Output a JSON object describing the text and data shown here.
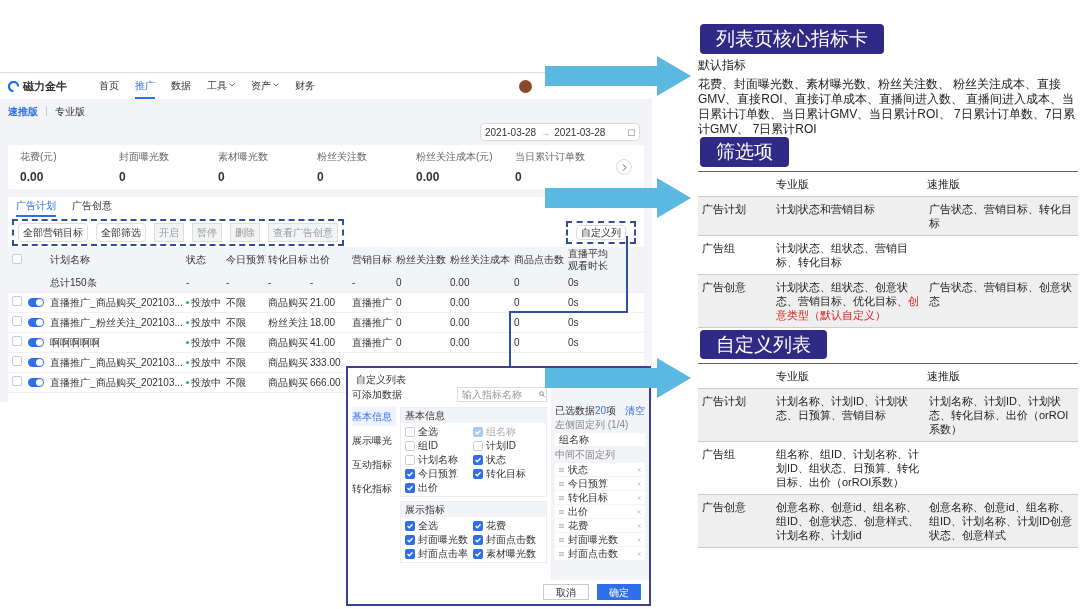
{
  "app": {
    "logo": "磁力金牛",
    "nav": [
      {
        "label": "首页",
        "selected": false,
        "dropdown": false
      },
      {
        "label": "推广",
        "selected": true,
        "dropdown": false
      },
      {
        "label": "数据",
        "selected": false,
        "dropdown": false
      },
      {
        "label": "工具",
        "selected": false,
        "dropdown": true
      },
      {
        "label": "资产",
        "selected": false,
        "dropdown": true
      },
      {
        "label": "财务",
        "selected": false,
        "dropdown": false
      }
    ],
    "versions": [
      {
        "label": "速推版",
        "selected": true
      },
      {
        "label": "专业版",
        "selected": false
      }
    ],
    "date_range": {
      "start": "2021-03-28",
      "separator": "→",
      "end": "2021-03-28"
    },
    "metrics": [
      {
        "label": "花费(元)",
        "value": "0.00"
      },
      {
        "label": "封面曝光数",
        "value": "0"
      },
      {
        "label": "素材曝光数",
        "value": "0"
      },
      {
        "label": "粉丝关注数",
        "value": "0"
      },
      {
        "label": "粉丝关注成本(元)",
        "value": "0.00"
      },
      {
        "label": "当日累计订单数",
        "value": "0"
      }
    ],
    "tabs": [
      {
        "label": "广告计划",
        "selected": true
      },
      {
        "label": "广告创意",
        "selected": false
      }
    ],
    "filters": [
      "全部营销目标",
      "全部筛选"
    ],
    "actions": [
      {
        "label": "开启",
        "disabled": true
      },
      {
        "label": "暂停",
        "disabled": true
      },
      {
        "label": "删除",
        "disabled": true
      },
      {
        "label": "查看广告创意",
        "disabled": true
      }
    ],
    "custom_columns_button": "自定义列",
    "select_all_checked": false,
    "columns": [
      "计划名称",
      "状态",
      "今日预算",
      "转化目标",
      "出价",
      "营销目标",
      "粉丝关注数",
      "粉丝关注成本",
      "商品点击数",
      "直播平均观看时长"
    ],
    "rows": [
      {
        "kind": "total",
        "cells": [
          "总计150条",
          "-",
          "-",
          "-",
          "-",
          "-",
          "0",
          "0.00",
          "0",
          "0s"
        ]
      },
      {
        "kind": "plan",
        "checked": false,
        "on": true,
        "cells": [
          "直播推广_商品购买_202103...",
          "投放中",
          "不限",
          "商品购买",
          "21.00",
          "直播推广",
          "0",
          "0.00",
          "0",
          "0s"
        ]
      },
      {
        "kind": "plan",
        "checked": false,
        "on": true,
        "cells": [
          "直播推广_粉丝关注_202103...",
          "投放中",
          "不限",
          "粉丝关注",
          "18.00",
          "直播推广",
          "0",
          "0.00",
          "0",
          "0s"
        ]
      },
      {
        "kind": "plan",
        "checked": false,
        "on": true,
        "cells": [
          "啊啊啊啊啊",
          "投放中",
          "不限",
          "商品购买",
          "41.00",
          "直播推广",
          "0",
          "0.00",
          "0",
          "0s"
        ]
      },
      {
        "kind": "plan",
        "checked": false,
        "on": true,
        "cells": [
          "直播推广_商品购买_202103...",
          "投放中",
          "不限",
          "商品购买",
          "333.00"
        ]
      },
      {
        "kind": "plan",
        "checked": false,
        "on": true,
        "cells": [
          "直播推广_商品购买_202103...",
          "投放中",
          "不限",
          "商品购买",
          "666.00"
        ]
      }
    ]
  },
  "dialog": {
    "title": "自定义列表",
    "subtitle": "可添加数据",
    "search": {
      "placeholder": "输入指标名称"
    },
    "categories": [
      {
        "label": "基本信息",
        "selected": true
      },
      {
        "label": "展示曝光",
        "selected": false
      },
      {
        "label": "互动指标",
        "selected": false
      },
      {
        "label": "转化指标",
        "selected": false
      }
    ],
    "sections": [
      {
        "title": "基本信息",
        "options": [
          {
            "label": "全选",
            "checked": false,
            "disabled": false
          },
          {
            "label": "组名称",
            "checked": true,
            "disabled": true
          },
          {
            "label": "组ID",
            "checked": false,
            "disabled": false
          },
          {
            "label": "计划ID",
            "checked": false,
            "disabled": false
          },
          {
            "label": "计划名称",
            "checked": false,
            "disabled": false
          },
          {
            "label": "状态",
            "checked": true,
            "disabled": false
          },
          {
            "label": "今日预算",
            "checked": true,
            "disabled": false
          },
          {
            "label": "转化目标",
            "checked": true,
            "disabled": false
          },
          {
            "label": "出价",
            "checked": true,
            "disabled": false
          }
        ]
      },
      {
        "title": "展示指标",
        "options": [
          {
            "label": "全选",
            "checked": true,
            "disabled": false
          },
          {
            "label": "花费",
            "checked": true,
            "disabled": false
          },
          {
            "label": "封面曝光数",
            "checked": true,
            "disabled": false
          },
          {
            "label": "封面点击数",
            "checked": true,
            "disabled": false
          },
          {
            "label": "封面点击率",
            "checked": true,
            "disabled": false
          },
          {
            "label": "素材曝光数",
            "checked": true,
            "disabled": false
          }
        ]
      }
    ],
    "selected_prefix": "已选数据",
    "selected_count": "20",
    "selected_suffix": "项",
    "clear": "清空",
    "fixed_label": "左侧固定列 (1/4)",
    "fixed_items": [
      "组名称"
    ],
    "movable_label": "中间不固定列",
    "movable_items": [
      "状态",
      "今日预算",
      "转化目标",
      "出价",
      "花费",
      "封面曝光数",
      "封面点击数"
    ],
    "cancel": "取消",
    "confirm": "确定"
  },
  "notes": [
    {
      "kind": "text",
      "title": "列表页核心指标卡",
      "lines": [
        "默认指标",
        "花费、封面曝光数、素材曝光数、粉丝关注数、 粉丝关注成本、直接GMV、直接ROI、直接订单成本、直播间进入数、 直播间进入成本、当日累计订单数、当日累计GMV、当日累计ROI、 7日累计订单数、7日累计GMV、 7日累计ROI"
      ]
    },
    {
      "kind": "table",
      "title": "筛选项",
      "headers": [
        "专业版",
        "速推版"
      ],
      "rows": [
        {
          "label": "广告计划",
          "pro": "计划状态和营销目标",
          "pro_highlight": "",
          "fast": "广告状态、营销目标、转化目标"
        },
        {
          "label": "广告组",
          "pro": "计划状态、组状态、营销目标、转化目标",
          "pro_highlight": "",
          "fast": ""
        },
        {
          "label": "广告创意",
          "pro": "计划状态、组状态、创意状态、营销目标、优化目标、",
          "pro_highlight": "创意类型（默认自定义）",
          "fast": "广告状态、营销目标、创意状态"
        }
      ]
    },
    {
      "kind": "table",
      "title": "自定义列表",
      "headers": [
        "专业版",
        "速推版"
      ],
      "rows": [
        {
          "label": "广告计划",
          "pro": "计划名称、计划ID、计划状态、日预算、营销目标",
          "pro_highlight": "",
          "fast": "计划名称、计划ID、计划状态、转化目标、出价（orROI系数）"
        },
        {
          "label": "广告组",
          "pro": "组名称、组ID、计划名称、计划ID、组状态、日预算、转化目标、出价（orROI系数）",
          "pro_highlight": "",
          "fast": ""
        },
        {
          "label": "广告创意",
          "pro": "创意名称、创意id、组名称、组ID、创意状态、创意样式、计划名称、计划id",
          "pro_highlight": "",
          "fast": "创意名称、创意id、组名称、组ID、计划名称、计划ID创意状态、创意样式"
        }
      ]
    }
  ]
}
